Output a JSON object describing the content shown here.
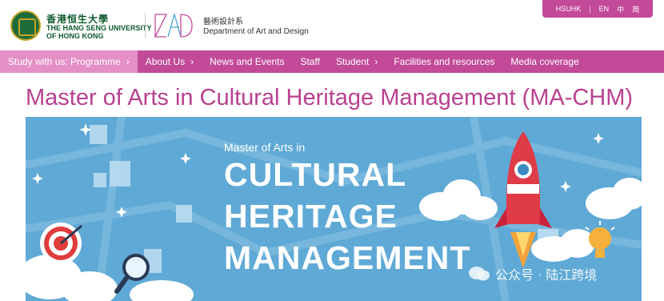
{
  "header": {
    "university_cn": "香港恒生大學",
    "university_en_line1": "THE HANG SENG UNIVERSITY",
    "university_en_line2": "OF HONG KONG",
    "dept_cn": "藝術設計系",
    "dept_en": "Department of Art and Design"
  },
  "topbar": {
    "hsuhk": "HSUHK",
    "separator": "|",
    "lang_en": "EN",
    "lang_tc": "中",
    "lang_sc": "简"
  },
  "nav": {
    "items": [
      {
        "label": "Study with us: Programme",
        "has_chevron": true
      },
      {
        "label": "About Us",
        "has_chevron": true
      },
      {
        "label": "News and Events",
        "has_chevron": false
      },
      {
        "label": "Staff",
        "has_chevron": false
      },
      {
        "label": "Student",
        "has_chevron": true
      },
      {
        "label": "Facilities and resources",
        "has_chevron": false
      },
      {
        "label": "Media coverage",
        "has_chevron": false
      }
    ],
    "chevron": "›"
  },
  "page": {
    "title": "Master of Arts in Cultural Heritage Management (MA-CHM)"
  },
  "banner": {
    "subtitle": "Master of Arts in",
    "line1": "CULTURAL",
    "line2": "HERITAGE",
    "line3": "MANAGEMENT"
  },
  "watermark": {
    "text": "公众号 · 陆江跨境"
  },
  "colors": {
    "brand_magenta": "#c24a99",
    "nav_active": "#e490c6",
    "title": "#b8418f",
    "university_green": "#0d5a2d",
    "banner_blue": "#5fa9d6"
  },
  "icons": [
    "university-seal-icon",
    "dad-logo-icon",
    "chevron-right-icon",
    "target-icon",
    "rocket-icon",
    "lightbulb-icon",
    "magnifier-icon",
    "wechat-icon"
  ]
}
